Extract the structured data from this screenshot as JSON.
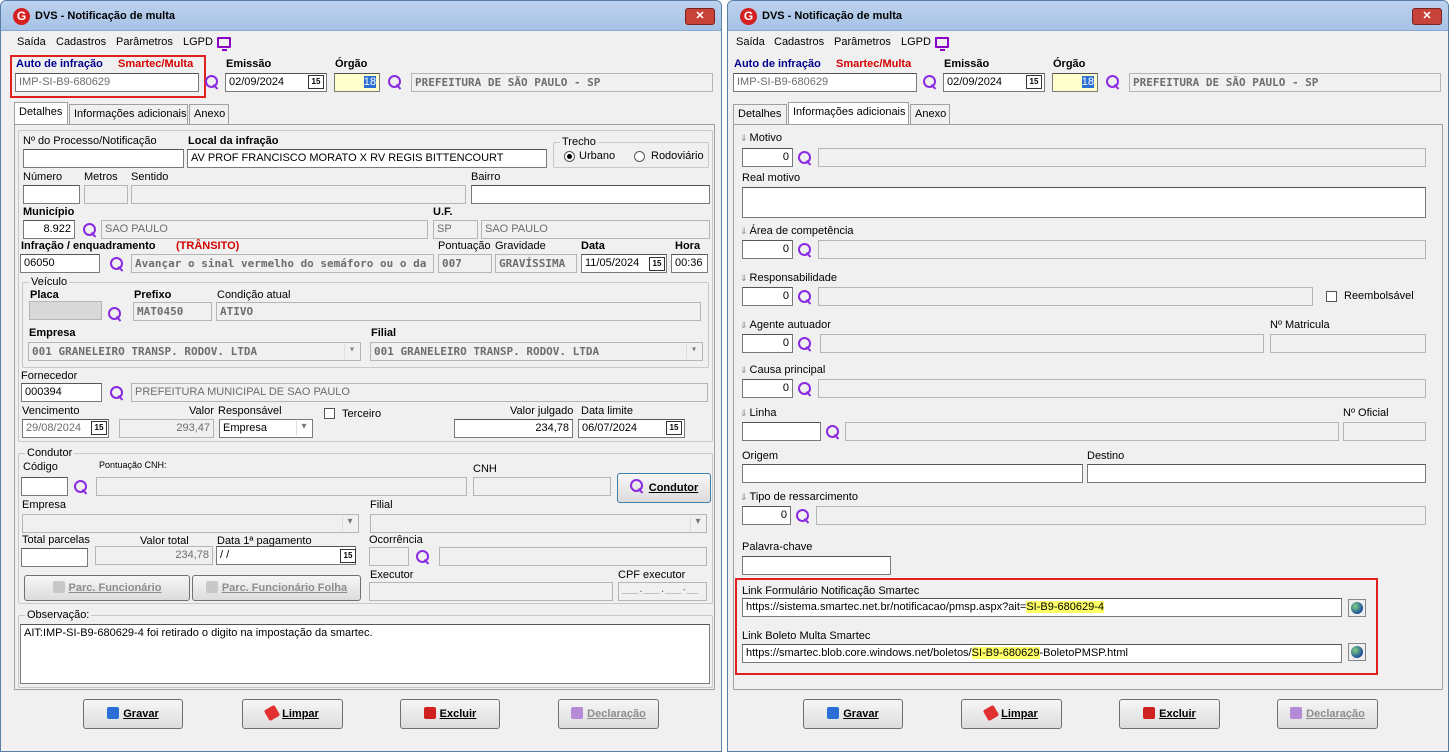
{
  "title": "DVS - Notificação de multa",
  "close": "✕",
  "menu": {
    "m1": "Saída",
    "m2": "Cadastros",
    "m3": "Parâmetros",
    "m4": "LGPD"
  },
  "auto": {
    "label": "Auto de infração",
    "tag": "Smartec/Multa",
    "value": "IMP-SI-B9-680629"
  },
  "emissao": {
    "label": "Emissão",
    "value": "02/09/2024"
  },
  "orgao": {
    "label": "Órgão",
    "code": "18",
    "name": "PREFEITURA DE SÃO PAULO - SP"
  },
  "tabs": [
    "Detalhes",
    "Informações adicionais",
    "Anexo"
  ],
  "cal": "15",
  "d": {
    "processo_label": "Nº do Processo/Notificação",
    "local_label": "Local da infração",
    "local": "AV PROF FRANCISCO MORATO X RV REGIS BITTENCOURT",
    "trecho": "Trecho",
    "urbano": "Urbano",
    "rodoviario": "Rodoviário",
    "numero": "Número",
    "metros": "Metros",
    "sentido": "Sentido",
    "bairro": "Bairro",
    "municipio_label": "Município",
    "municipio_code": "8.922",
    "municipio": "SAO PAULO",
    "uf_label": "U.F.",
    "uf": "SP",
    "uf_name": "SAO PAULO",
    "infracao_label": "Infração / enquadramento",
    "infracao_tag": "(TRÂNSITO)",
    "pontuacao": "Pontuação",
    "gravidade": "Gravidade",
    "data": "Data",
    "hora": "Hora",
    "infracao_code": "06050",
    "infracao_desc": "Avançar o sinal vermelho do semáforo ou o da parad",
    "pontos": "007",
    "grav": "GRAVÍSSIMA",
    "data_val": "11/05/2024",
    "hora_val": "00:36",
    "veiculo": "Veículo",
    "placa": "Placa",
    "placa_val": "",
    "prefixo": "Prefixo",
    "prefixo_val": "MAT0450",
    "cond_atual": "Condição atual",
    "cond_val": "ATIVO",
    "empresa": "Empresa",
    "empresa_val": "001 GRANELEIRO TRANSP. RODOV. LTDA",
    "filial": "Filial",
    "filial_val": "001 GRANELEIRO TRANSP. RODOV. LTDA",
    "fornecedor": "Fornecedor",
    "forn_code": "000394",
    "forn_name": "PREFEITURA  MUNICIPAL DE SAO PAULO",
    "vencimento": "Vencimento",
    "venc_val": "29/08/2024",
    "valor": "Valor",
    "valor_val": "293,47",
    "responsavel": "Responsável",
    "resp_val": "Empresa",
    "terceiro": "Terceiro",
    "valor_julgado": "Valor julgado",
    "vj_val": "234,78",
    "data_limite": "Data limite",
    "dl_val": "06/07/2024",
    "condutor": "Condutor",
    "codigo": "Código",
    "pont_cnh": "Pontuação CNH:",
    "cnh": "CNH",
    "condutor_btn": "Condutor",
    "empresa2": "Empresa",
    "filial2": "Filial",
    "total_parc": "Total parcelas",
    "valor_total": "Valor total",
    "vt_val": "234,78",
    "data_pag": "Data 1ª pagamento",
    "dp_val": " / /",
    "ocorrencia": "Ocorrência",
    "parc_func": "Parc. Funcionário",
    "parc_folha": "Parc. Funcionário Folha",
    "executor": "Executor",
    "cpf_exec": "CPF executor",
    "cpf_val": "___.___.___-__",
    "observacao": "Observação:",
    "obs_val": "AIT:IMP-SI-B9-680629-4 foi retirado o digito na impostação da smartec."
  },
  "i": {
    "motivo": "Motivo",
    "zero": "0",
    "real_motivo": "Real motivo",
    "area": "Área de competência",
    "resp": "Responsabilidade",
    "reemb": "Reembolsável",
    "agente": "Agente autuador",
    "matricula": "Nº Matricula",
    "causa": "Causa principal",
    "linha": "Linha",
    "oficial": "Nº Oficial",
    "origem": "Origem",
    "destino": "Destino",
    "tipo": "Tipo de ressarcimento",
    "palavra": "Palavra-chave",
    "link1_label": "Link Formulário Notificação Smartec",
    "link1_pre": "https://sistema.smartec.net.br/notificacao/pmsp.aspx?ait=",
    "link1_hl": "SI-B9-680629-4",
    "link2_label": "Link Boleto Multa Smartec",
    "link2_pre": "https://smartec.blob.core.windows.net/boletos/",
    "link2_hl": "SI-B9-680629",
    "link2_post": "-BoletoPMSP.html"
  },
  "buttons": {
    "gravar": "Gravar",
    "limpar": "Limpar",
    "excluir": "Excluir",
    "declaracao": "Declaração"
  }
}
